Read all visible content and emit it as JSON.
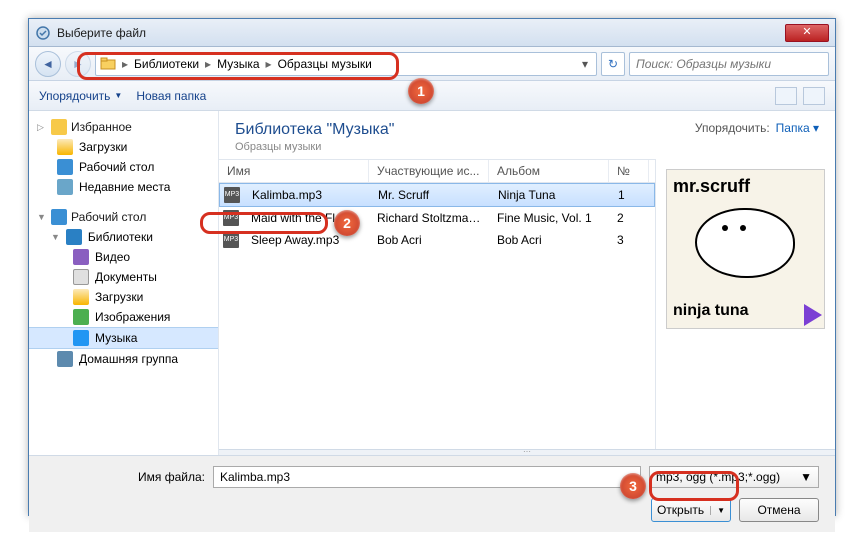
{
  "window": {
    "title": "Выберите файл"
  },
  "breadcrumb": {
    "root": "Библиотеки",
    "lvl2": "Музыка",
    "lvl3": "Образцы музыки"
  },
  "search": {
    "placeholder": "Поиск: Образцы музыки"
  },
  "toolbar": {
    "organize": "Упорядочить",
    "newfolder": "Новая папка"
  },
  "sidebar": {
    "fav": "Избранное",
    "downloads": "Загрузки",
    "desktop": "Рабочий стол",
    "recent": "Недавние места",
    "desktop2": "Рабочий стол",
    "libraries": "Библиотеки",
    "video": "Видео",
    "documents": "Документы",
    "downloads2": "Загрузки",
    "images": "Изображения",
    "music": "Музыка",
    "homegroup": "Домашняя группа"
  },
  "libheader": {
    "title": "Библиотека \"Музыка\"",
    "subtitle": "Образцы музыки",
    "arrange_label": "Упорядочить:",
    "arrange_value": "Папка"
  },
  "columns": {
    "name": "Имя",
    "artist": "Участвующие ис...",
    "album": "Альбом",
    "num": "№"
  },
  "files": [
    {
      "name": "Kalimba.mp3",
      "artist": "Mr. Scruff",
      "album": "Ninja Tuna",
      "num": "1"
    },
    {
      "name": "Maid with the Flax...",
      "artist": "Richard Stoltzman...",
      "album": "Fine Music, Vol. 1",
      "num": "2"
    },
    {
      "name": "Sleep Away.mp3",
      "artist": "Bob Acri",
      "album": "Bob Acri",
      "num": "3"
    }
  ],
  "preview": {
    "artist": "mr.scruff",
    "album": "ninja tuna"
  },
  "footer": {
    "filename_label": "Имя файла:",
    "filename_value": "Kalimba.mp3",
    "filter": "mp3, ogg (*.mp3;*.ogg)",
    "open": "Открыть",
    "cancel": "Отмена"
  },
  "callouts": {
    "c1": "1",
    "c2": "2",
    "c3": "3"
  }
}
